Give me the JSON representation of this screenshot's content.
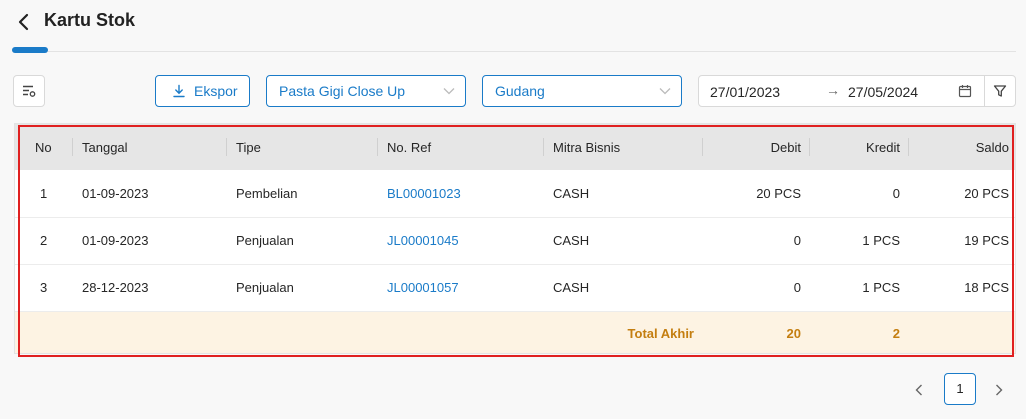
{
  "header": {
    "title": "Kartu Stok"
  },
  "toolbar": {
    "export_label": "Ekspor",
    "product_value": "Pasta Gigi Close Up",
    "warehouse_value": "Gudang",
    "date_from": "27/01/2023",
    "date_to": "27/05/2024",
    "date_separator": "→"
  },
  "table": {
    "columns": [
      "No",
      "Tanggal",
      "Tipe",
      "No. Ref",
      "Mitra Bisnis",
      "Debit",
      "Kredit",
      "Saldo"
    ],
    "rows": [
      {
        "no": "1",
        "tanggal": "01-09-2023",
        "tipe": "Pembelian",
        "ref": "BL00001023",
        "mitra": "CASH",
        "debit": "20 PCS",
        "kredit": "0",
        "saldo": "20 PCS"
      },
      {
        "no": "2",
        "tanggal": "01-09-2023",
        "tipe": "Penjualan",
        "ref": "JL00001045",
        "mitra": "CASH",
        "debit": "0",
        "kredit": "1 PCS",
        "saldo": "19 PCS"
      },
      {
        "no": "3",
        "tanggal": "28-12-2023",
        "tipe": "Penjualan",
        "ref": "JL00001057",
        "mitra": "CASH",
        "debit": "0",
        "kredit": "1 PCS",
        "saldo": "18 PCS"
      }
    ],
    "total": {
      "label": "Total Akhir",
      "debit": "20",
      "kredit": "2"
    }
  },
  "pagination": {
    "current": "1"
  },
  "colors": {
    "accent": "#1a7bc8",
    "total_bg": "#fdf3e3",
    "total_text": "#c47e10",
    "highlight": "#e02020"
  }
}
